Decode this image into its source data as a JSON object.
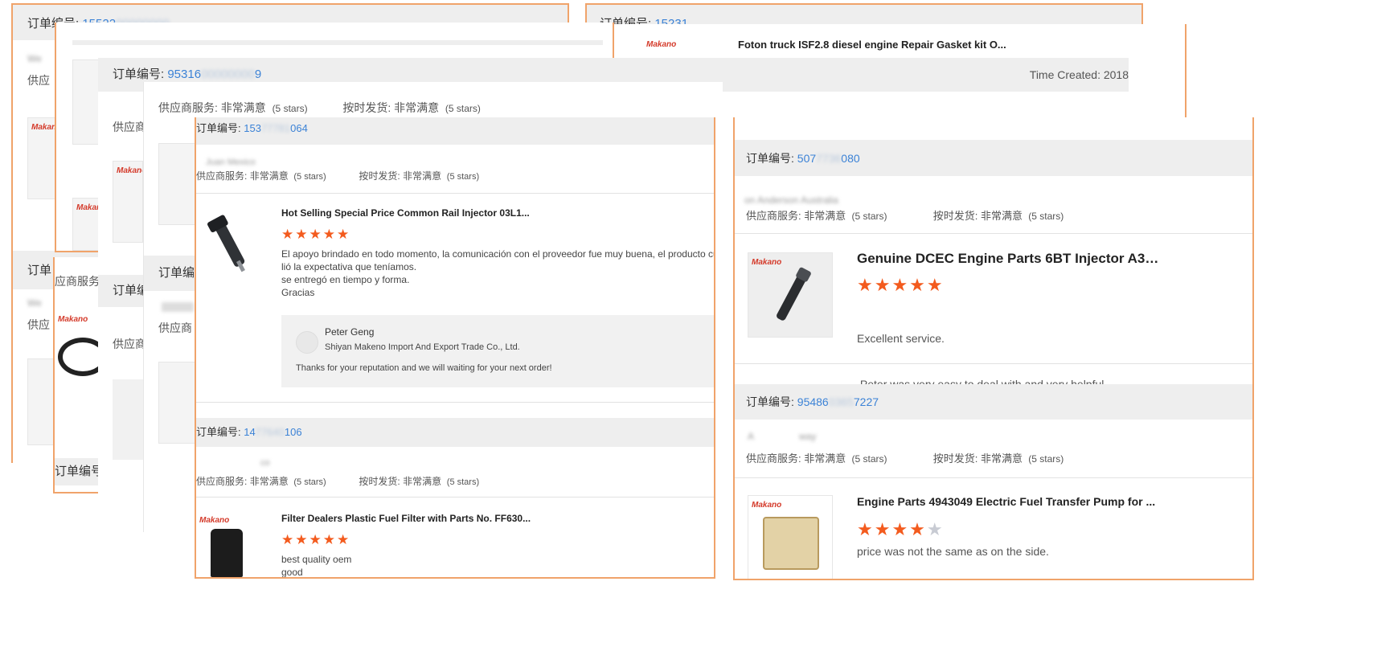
{
  "order_prefix": "订单编号:",
  "rating_supplier_label": "供应商服务:",
  "rating_shipping_label": "按时发货:",
  "rating_value": "非常满意",
  "rating_stars_text": "(5 stars)",
  "back_left": {
    "order_number": "15522",
    "buyer_blur": "We",
    "supplier_label_partial": "供应",
    "order_label_partial": "订单",
    "buyer_blur2": "We",
    "supplier_label_partial2": "供应"
  },
  "back_right": {
    "order_number": "15231",
    "product_title": "Foton truck ISF2.8 diesel engine Repair Gasket kit O..."
  },
  "middle_card": {
    "order_number": "95316",
    "order_number_tail": "9",
    "time_created": "Time Created: 2018",
    "supplier_label_partial": "供应商",
    "order_label_partial": "订单编",
    "supplier_label_partial2": "供应商",
    "partial_n": "N"
  },
  "left_stack": {
    "supplier_partial": "应商服务",
    "order_label": "订单编号:"
  },
  "card4": {
    "supplier_label_partial": "供应商",
    "order_label_partial": "订单编"
  },
  "main_left": {
    "order1": {
      "number_start": "153",
      "number_end": "064",
      "buyer_blur": "Juan Mexico",
      "rating_supplier_label": "供应商服务:",
      "product_title": "Hot Selling Special Price Common Rail Injector 03L1...",
      "stars": "★★★★★",
      "review_lines": [
        "El apoyo brindado en todo momento, la comunicación con el proveedor fue muy buena, el producto cump",
        "lió la expectativa que teníamos.",
        "se entregó en tiempo y forma.",
        "Gracias"
      ],
      "reply": {
        "name": "Peter Geng",
        "company": "Shiyan Makeno Import And Export Trade Co., Ltd.",
        "message": "Thanks for your reputation and we will waiting for your next order!"
      }
    },
    "order2": {
      "number_start": "14",
      "number_end": "106",
      "buyer_blur": "co",
      "product_title": "Filter Dealers Plastic Fuel Filter with Parts No. FF630...",
      "stars": "★★★★★",
      "review_lines": [
        "best  quality oem",
        "good"
      ]
    }
  },
  "main_right": {
    "order1": {
      "number_start": "507",
      "number_end": "080",
      "buyer_blur": "on Anderson Australia",
      "product_title": "Genuine DCEC Engine Parts 6BT Injector A328...",
      "stars": "★★★★★",
      "review_lines": [
        "Excellent service.",
        " Peter was very easy to deal with and very helpful."
      ]
    },
    "order2": {
      "number_start": "95486",
      "number_end": "7227",
      "buyer_blur": "A                 way",
      "product_title": "Engine Parts 4943049 Electric Fuel Transfer Pump for ...",
      "stars_on": "★★★★",
      "stars_off": "★",
      "rating": 4,
      "review_lines": [
        "price was not the same as on the side."
      ]
    }
  },
  "logo_text": "Makano",
  "colors": {
    "accent_orange": "#f35b1e",
    "border_orange": "#f0a36a",
    "link_blue": "#3b82d6"
  }
}
